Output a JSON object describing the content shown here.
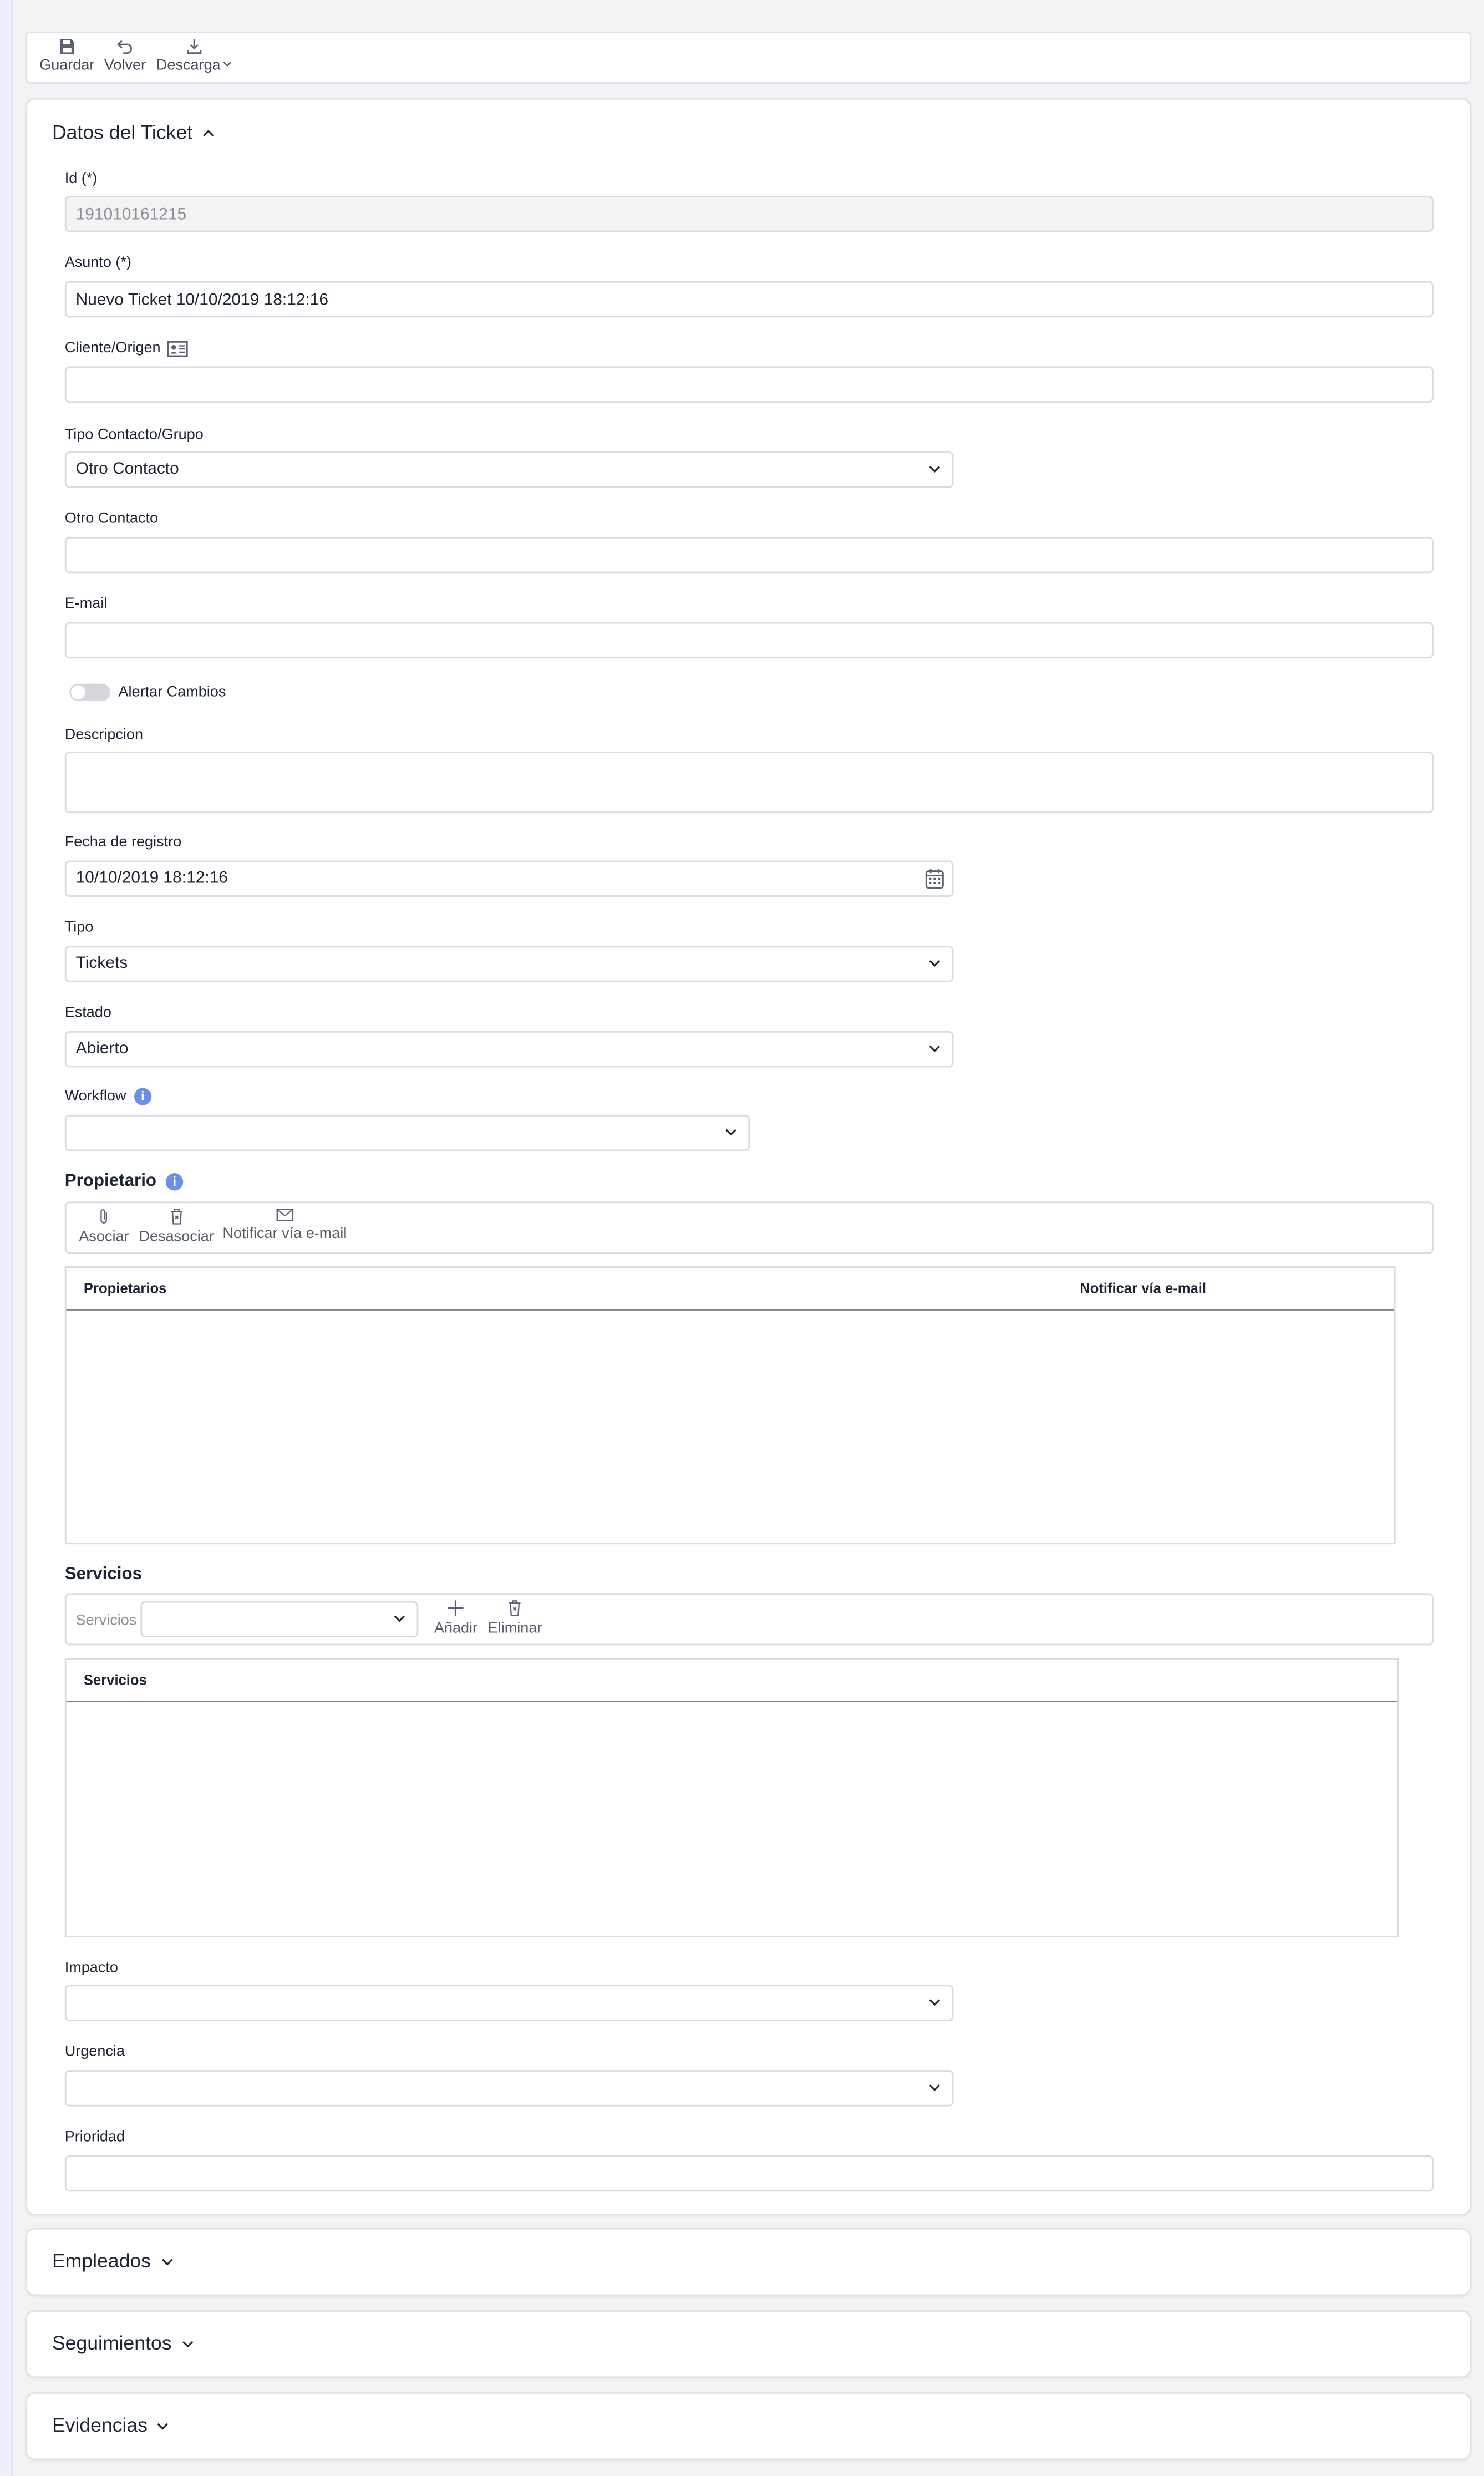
{
  "toolbar": {
    "save_label": "Guardar",
    "back_label": "Volver",
    "download_label": "Descarga"
  },
  "ticket": {
    "title": "Datos del Ticket",
    "id_label": "Id (*)",
    "id_value": "191010161215",
    "subject_label": "Asunto (*)",
    "subject_value": "Nuevo Ticket 10/10/2019 18:12:16",
    "client_label": "Cliente/Origen",
    "client_value": "",
    "contact_type_label": "Tipo Contacto/Grupo",
    "contact_type_value": "Otro Contacto",
    "other_contact_label": "Otro Contacto",
    "other_contact_value": "",
    "email_label": "E-mail",
    "email_value": "",
    "alert_label": "Alertar Cambios",
    "alert_on": false,
    "description_label": "Descripcion",
    "description_value": "",
    "date_label": "Fecha de registro",
    "date_value": "10/10/2019 18:12:16",
    "type_label": "Tipo",
    "type_value": "Tickets",
    "status_label": "Estado",
    "status_value": "Abierto",
    "workflow_label": "Workflow",
    "workflow_value": "",
    "impact_label": "Impacto",
    "impact_value": "",
    "urgency_label": "Urgencia",
    "urgency_value": "",
    "priority_label": "Prioridad",
    "priority_value": ""
  },
  "owners": {
    "title": "Propietario",
    "associate_label": "Asociar",
    "disassociate_label": "Desasociar",
    "notify_label": "Notificar vía e-mail",
    "columns": [
      "Propietarios",
      "Notificar vía e-mail"
    ],
    "rows": []
  },
  "services": {
    "title": "Servicios",
    "select_label": "Servicios",
    "select_value": "",
    "add_label": "Añadir",
    "delete_label": "Eliminar",
    "columns": [
      "Servicios"
    ],
    "rows": []
  },
  "sections": {
    "employees": "Empleados",
    "followups": "Seguimientos",
    "evidence": "Evidencias"
  },
  "colors": {
    "accent": "#6e8fe6",
    "border": "#d8dbe0",
    "background": "#f3f3f5"
  }
}
